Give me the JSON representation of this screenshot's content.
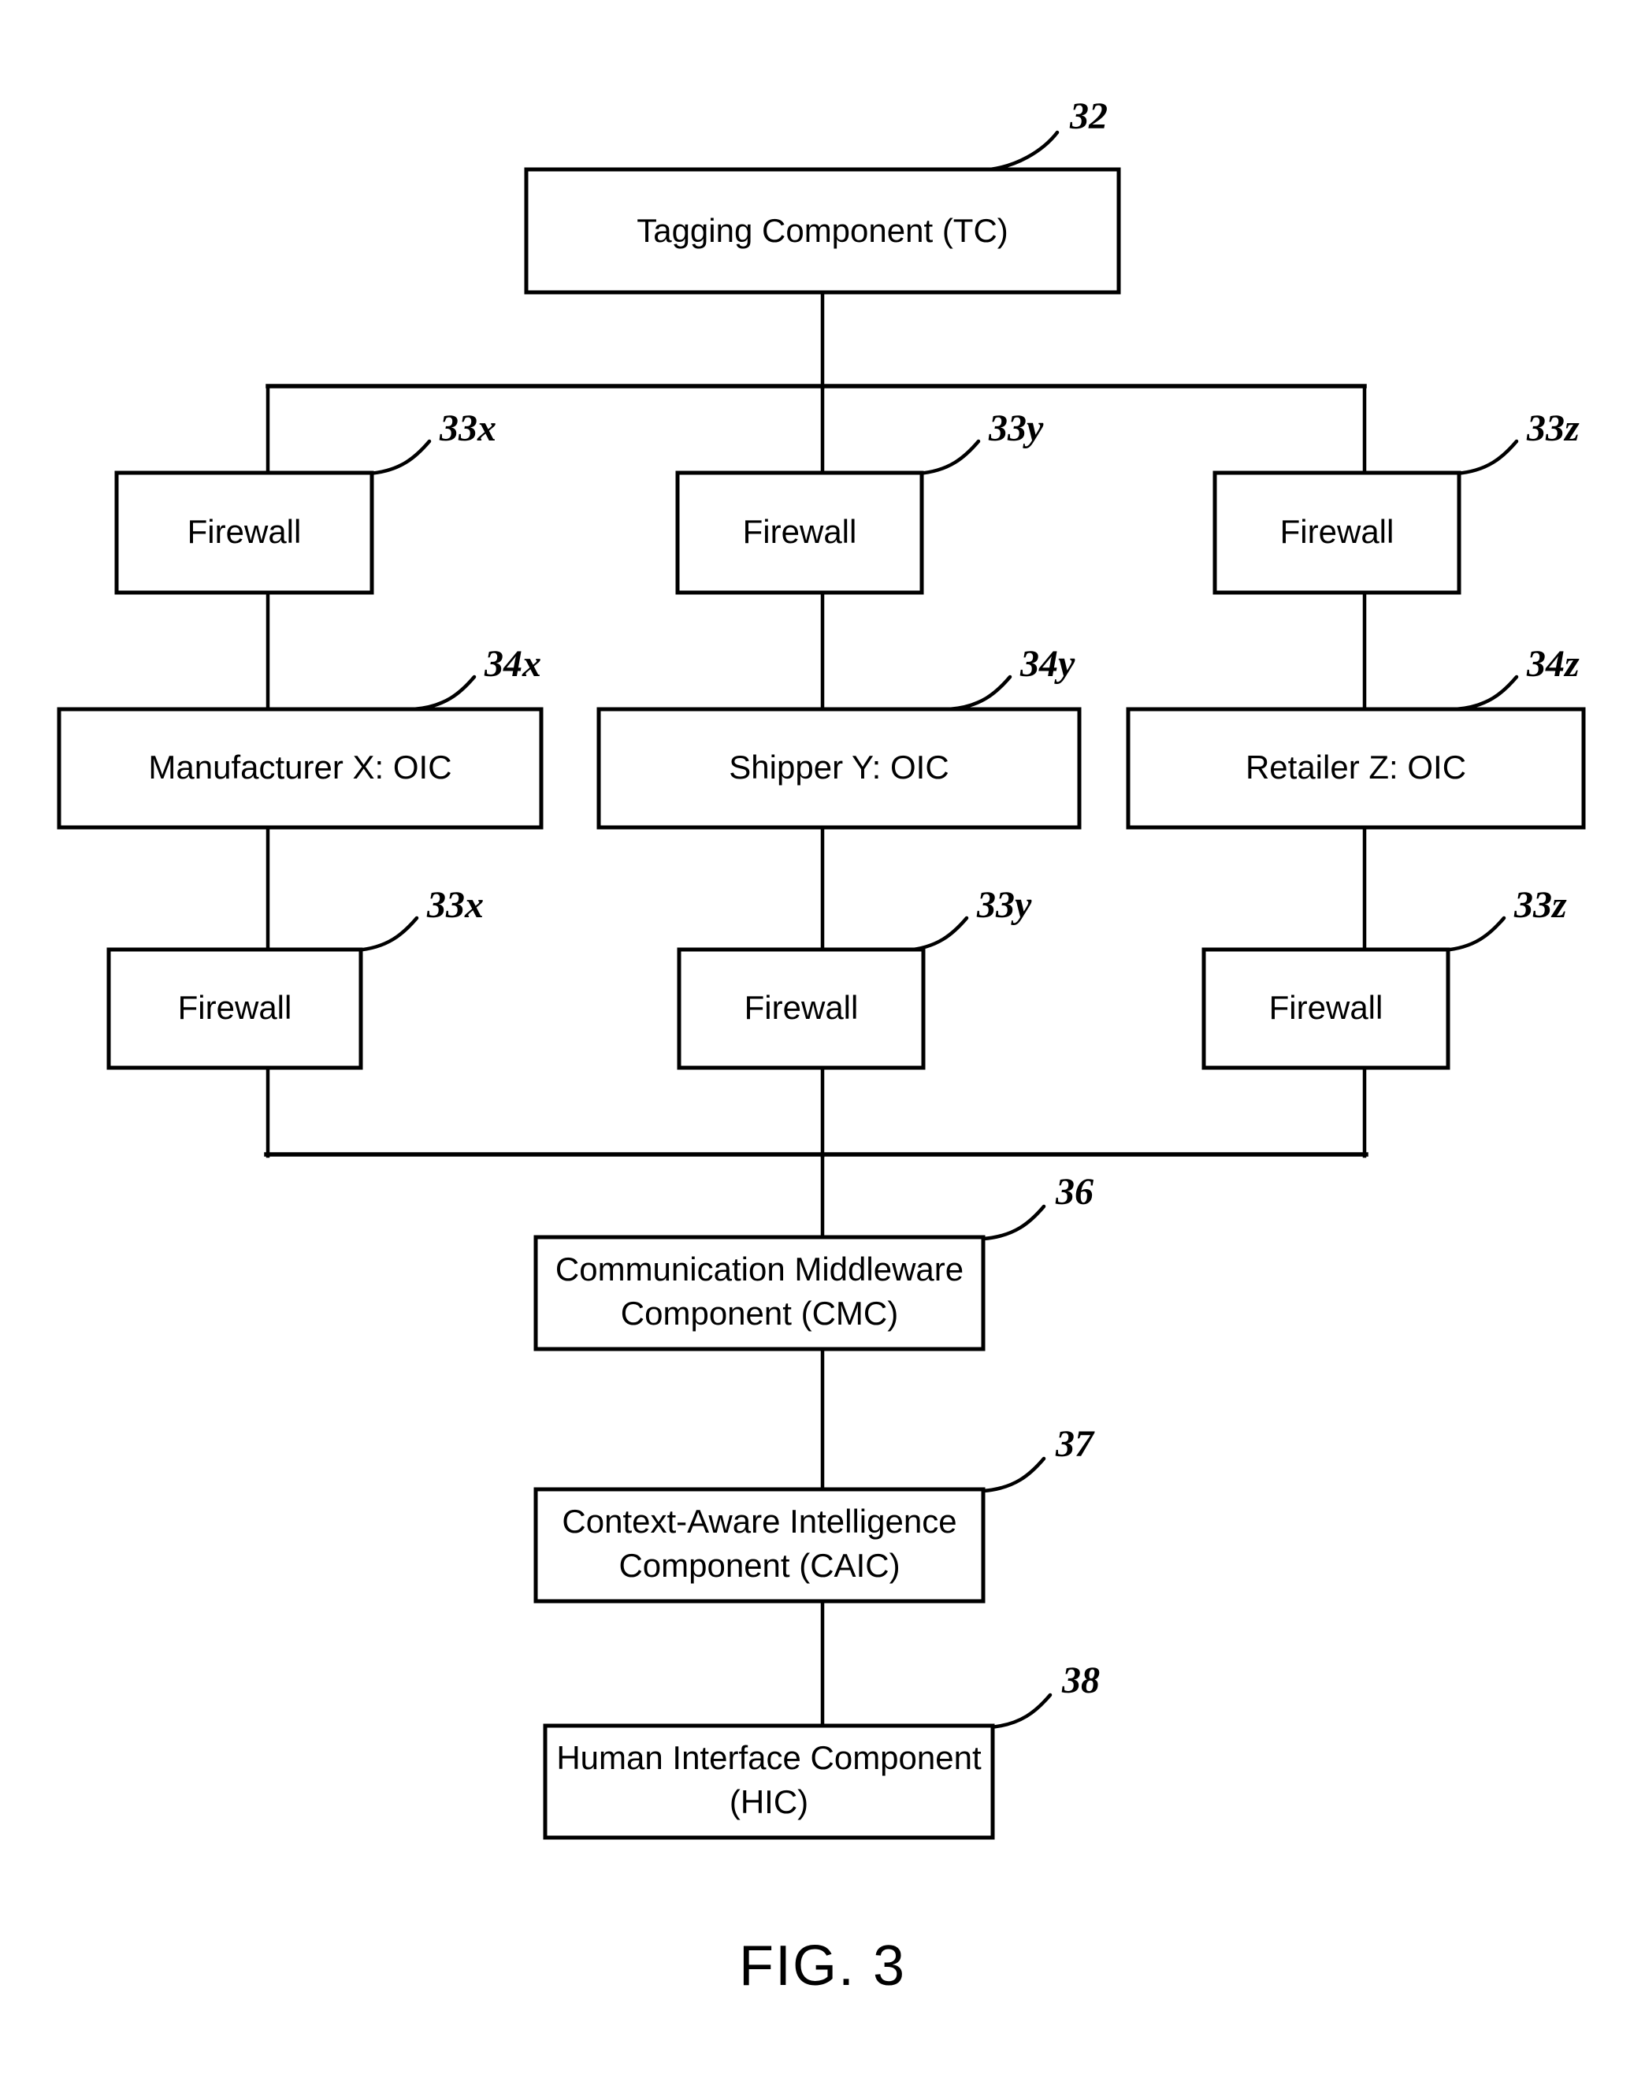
{
  "figure": {
    "caption": "FIG. 3",
    "type": "patent-block-diagram"
  },
  "nodes": {
    "tagging_component": {
      "label": "Tagging Component (TC)",
      "ref": "32"
    },
    "firewall_x_top": {
      "label": "Firewall",
      "ref": "33x"
    },
    "firewall_y_top": {
      "label": "Firewall",
      "ref": "33y"
    },
    "firewall_z_top": {
      "label": "Firewall",
      "ref": "33z"
    },
    "manufacturer_x": {
      "label": "Manufacturer X: OIC",
      "ref": "34x"
    },
    "shipper_y": {
      "label": "Shipper Y: OIC",
      "ref": "34y"
    },
    "retailer_z": {
      "label": "Retailer Z: OIC",
      "ref": "34z"
    },
    "firewall_x_bottom": {
      "label": "Firewall",
      "ref": "33x"
    },
    "firewall_y_bottom": {
      "label": "Firewall",
      "ref": "33y"
    },
    "firewall_z_bottom": {
      "label": "Firewall",
      "ref": "33z"
    },
    "communication_middleware": {
      "label_line1": "Communication Middleware",
      "label_line2": "Component (CMC)",
      "ref": "36"
    },
    "context_aware_intelligence": {
      "label_line1": "Context-Aware Intelligence",
      "label_line2": "Component (CAIC)",
      "ref": "37"
    },
    "human_interface": {
      "label_line1": "Human Interface Component",
      "label_line2": "(HIC)",
      "ref": "38"
    }
  },
  "style": {
    "line_color": "#000000",
    "box_fill": "#ffffff",
    "background": "#ffffff"
  }
}
